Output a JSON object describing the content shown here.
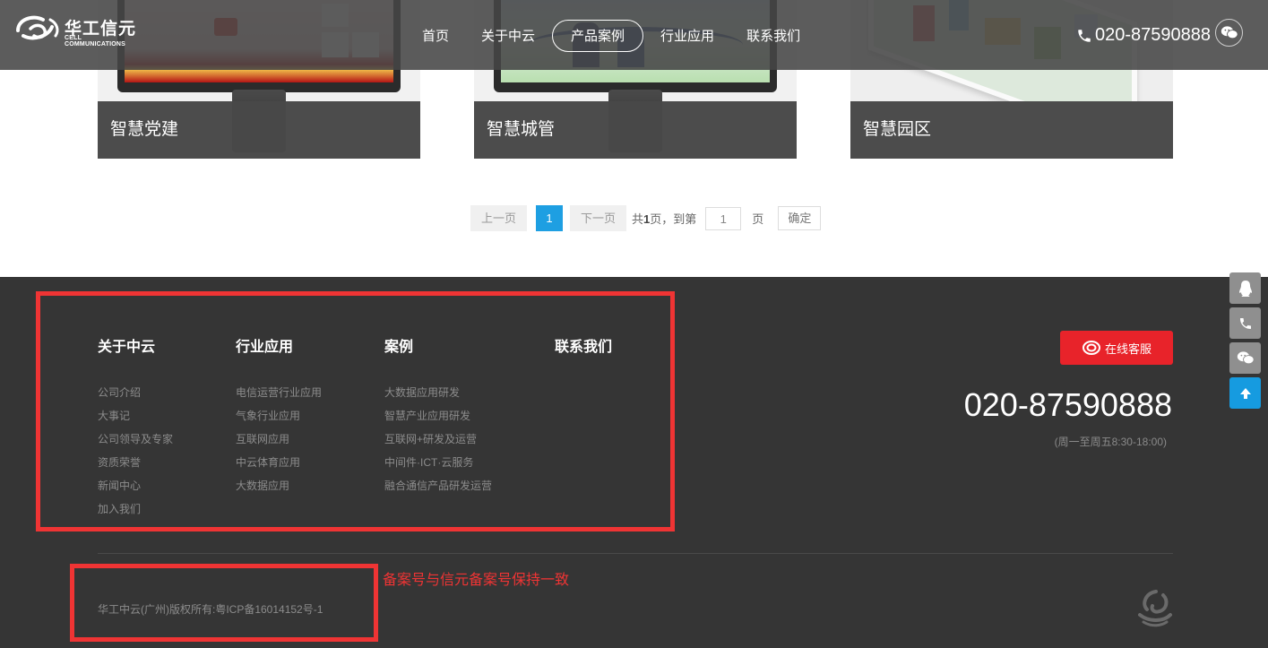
{
  "header": {
    "logo_cn": "华工信元",
    "logo_en": "CELL COMMUNICATIONS",
    "nav": [
      {
        "label": "首页",
        "active": false
      },
      {
        "label": "关于中云",
        "active": false
      },
      {
        "label": "产品案例",
        "active": true
      },
      {
        "label": "行业应用",
        "active": false
      },
      {
        "label": "联系我们",
        "active": false
      }
    ],
    "phone": "020-87590888",
    "icons": {
      "phone": "phone-icon",
      "wechat": "wechat-icon"
    }
  },
  "cases": [
    {
      "title": "智慧党建"
    },
    {
      "title": "智慧城管"
    },
    {
      "title": "智慧园区"
    }
  ],
  "pagination": {
    "prev": "上一页",
    "current": "1",
    "next": "下一页",
    "total_prefix": "共",
    "total": "1",
    "total_suffix": "页，到第",
    "page_input": "1",
    "page_unit": "页",
    "confirm": "确定"
  },
  "footer": {
    "columns": [
      {
        "title": "关于中云",
        "links": [
          "公司介绍",
          "大事记",
          "公司领导及专家",
          "资质荣誉",
          "新闻中心",
          "加入我们"
        ]
      },
      {
        "title": "行业应用",
        "links": [
          "电信运营行业应用",
          "气象行业应用",
          "互联网应用",
          "中云体育应用",
          "大数据应用"
        ]
      },
      {
        "title": "案例",
        "links": [
          "大数据应用研发",
          "智慧产业应用研发",
          "互联网+研发及运营",
          "中间件·ICT·云服务",
          "融合通信产品研发运营"
        ]
      },
      {
        "title": "联系我们",
        "links": []
      }
    ],
    "service_button": "在线客服",
    "phone": "020-87590888",
    "hours": "(周一至周五8:30-18:00)",
    "annotation": "备案号与信元备案号保持一致",
    "copyright": "华工中云(广州)版权所有:粤ICP备16014152号-1"
  },
  "side_tools": [
    "qq-icon",
    "phone-icon",
    "wechat-icon",
    "back-to-top-icon"
  ],
  "colors": {
    "accent_blue": "#1e9fe2",
    "accent_red": "#e8232a",
    "annotation_red": "#ef3434",
    "footer_bg": "#353535"
  }
}
